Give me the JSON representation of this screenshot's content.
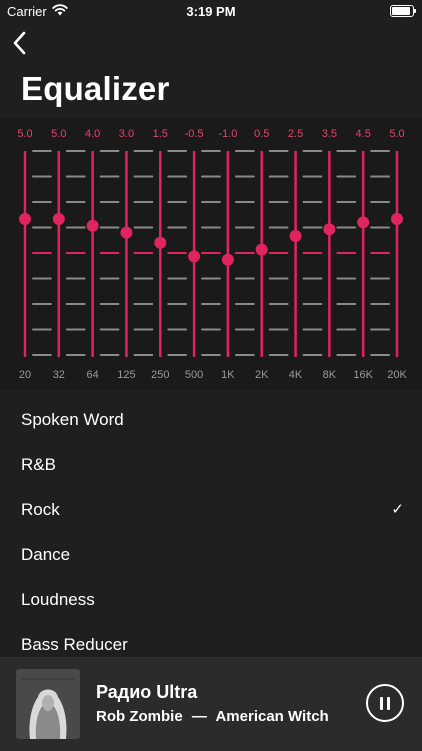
{
  "status": {
    "carrier": "Carrier",
    "time": "3:19 PM"
  },
  "nav": {
    "title": "Equalizer"
  },
  "equalizer": {
    "bands": [
      {
        "freq": "20",
        "gain": 5.0,
        "gain_label": "5.0"
      },
      {
        "freq": "32",
        "gain": 5.0,
        "gain_label": "5.0"
      },
      {
        "freq": "64",
        "gain": 4.0,
        "gain_label": "4.0"
      },
      {
        "freq": "125",
        "gain": 3.0,
        "gain_label": "3.0"
      },
      {
        "freq": "250",
        "gain": 1.5,
        "gain_label": "1.5"
      },
      {
        "freq": "500",
        "gain": -0.5,
        "gain_label": "-0.5"
      },
      {
        "freq": "1K",
        "gain": -1.0,
        "gain_label": "-1.0"
      },
      {
        "freq": "2K",
        "gain": 0.5,
        "gain_label": "0.5"
      },
      {
        "freq": "4K",
        "gain": 2.5,
        "gain_label": "2.5"
      },
      {
        "freq": "8K",
        "gain": 3.5,
        "gain_label": "3.5"
      },
      {
        "freq": "16K",
        "gain": 4.5,
        "gain_label": "4.5"
      },
      {
        "freq": "20K",
        "gain": 5.0,
        "gain_label": "5.0"
      }
    ],
    "gain_range": [
      -15,
      15
    ],
    "accent": "#e0245e",
    "tick_color": "#8a8a8a"
  },
  "presets": {
    "items": [
      {
        "label": "Spoken Word",
        "selected": false
      },
      {
        "label": "R&B",
        "selected": false
      },
      {
        "label": "Rock",
        "selected": true
      },
      {
        "label": "Dance",
        "selected": false
      },
      {
        "label": "Loudness",
        "selected": false
      },
      {
        "label": "Bass Reducer",
        "selected": false
      }
    ],
    "check_glyph": "✓"
  },
  "player": {
    "station": "Радио Ultra",
    "artist": "Rob Zombie",
    "separator": "—",
    "title": "American Witch",
    "artwork_text": "ROB ZOMBIE"
  }
}
